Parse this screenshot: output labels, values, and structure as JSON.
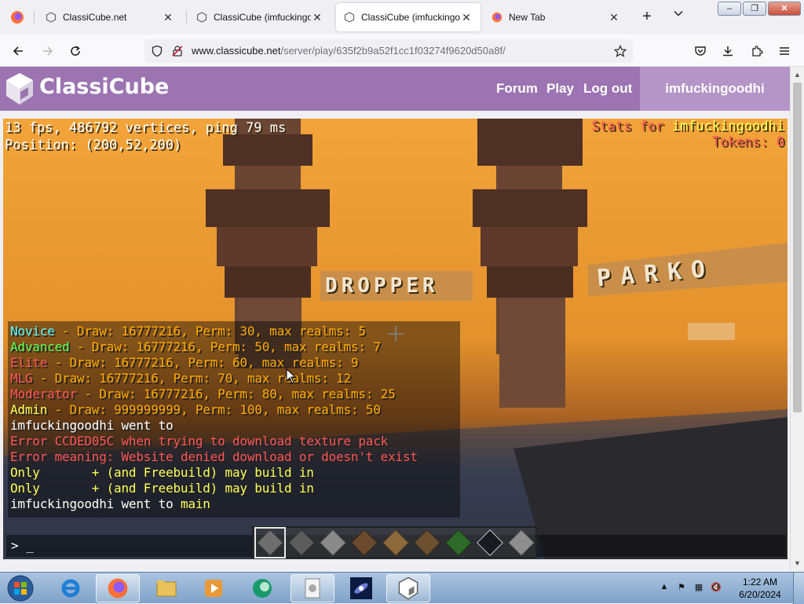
{
  "browser": {
    "tabs": [
      {
        "title": "ClassiCube.net",
        "close": "✕"
      },
      {
        "title": "ClassiCube (imfuckingoodhi)",
        "close": "✕"
      },
      {
        "title": "ClassiCube (imfuckingoodhi)",
        "close": "✕"
      },
      {
        "title": "New Tab",
        "close": "✕"
      }
    ],
    "new_tab_label": "+",
    "url_domain": "www.classicube.net",
    "url_path": "/server/play/635f2b9a52f1cc1f03274f9620d50a8f/",
    "window_buttons": {
      "minimize": "–",
      "restore": "❐",
      "close": "✕"
    }
  },
  "site": {
    "logo_text": "ClassiCube",
    "nav": {
      "forum": "Forum",
      "play": "Play",
      "logout": "Log out"
    },
    "username": "imfuckingoodhi"
  },
  "game": {
    "hud": {
      "fps_line": "13 fps, 486792 vertices, ping 79 ms",
      "position_line": "Position: (200,52,200)"
    },
    "stats": {
      "label": "Stats for",
      "name": "imfuckingoodhi",
      "tokens": "Tokens: 0"
    },
    "signs": {
      "dropper": "DROPPER",
      "parkour": "PARKO"
    },
    "chat": [
      {
        "rank": "Novice",
        "rank_color": "#55ffff",
        "rest": " - Draw: 16777216, Perm: 30, max realms: 5"
      },
      {
        "rank": "Advanced",
        "rank_color": "#55ff55",
        "rest": " - Draw: 16777216, Perm: 50, max realms: 7"
      },
      {
        "rank": "Elite",
        "rank_color": "#ff5555",
        "rest": " - Draw: 16777216, Perm: 60, max realms: 9"
      },
      {
        "rank": "MLG",
        "rank_color": "#ff5555",
        "rest": " - Draw: 16777216, Perm: 70, max realms: 12"
      },
      {
        "rank": "Moderator",
        "rank_color": "#ff5555",
        "rest": " - Draw: 16777216, Perm: 80, max realms: 25"
      },
      {
        "rank": "Admin",
        "rank_color": "#ffff55",
        "rest": " - Draw: 999999999, Perm: 100, max realms: 50"
      }
    ],
    "chat_went_to": {
      "player": "imfuckingoodhi",
      "text": " went to"
    },
    "chat_error": "Error CCDED05C when trying to download texture pack",
    "chat_error_meaning": "  Error meaning: Website denied download or doesn't exist",
    "chat_only_1": {
      "prefix": "Only",
      "suffix": "+ (and Freebuild) may build in"
    },
    "chat_only_2": {
      "prefix": "Only",
      "suffix": "+ (and Freebuild) may build in"
    },
    "chat_main": {
      "player": "imfuckingoodhi",
      "text": " went to ",
      "map": "main"
    },
    "chat_prompt": "> _",
    "colors": {
      "rest": "#ffaa00",
      "error": "#ff5555",
      "map": "#ffff55",
      "white": "#ffffff"
    },
    "hotbar": [
      {
        "name": "stone",
        "color": "#6e6e6e",
        "selected": true
      },
      {
        "name": "cobblestone",
        "color": "#5c5c5c",
        "selected": false
      },
      {
        "name": "stone-alt",
        "color": "#8a8a8a",
        "selected": false
      },
      {
        "name": "dirt",
        "color": "#6b4a2e",
        "selected": false
      },
      {
        "name": "wood-planks",
        "color": "#8c6a3c",
        "selected": false
      },
      {
        "name": "log",
        "color": "#6d5030",
        "selected": false
      },
      {
        "name": "leaves",
        "color": "#2e6a2a",
        "selected": false
      },
      {
        "name": "glass",
        "color": "#1a1a22",
        "selected": false
      },
      {
        "name": "slab",
        "color": "#8e8e8e",
        "selected": false
      }
    ]
  },
  "taskbar": {
    "clock_time": "1:22 AM",
    "clock_date": "6/20/2024"
  }
}
